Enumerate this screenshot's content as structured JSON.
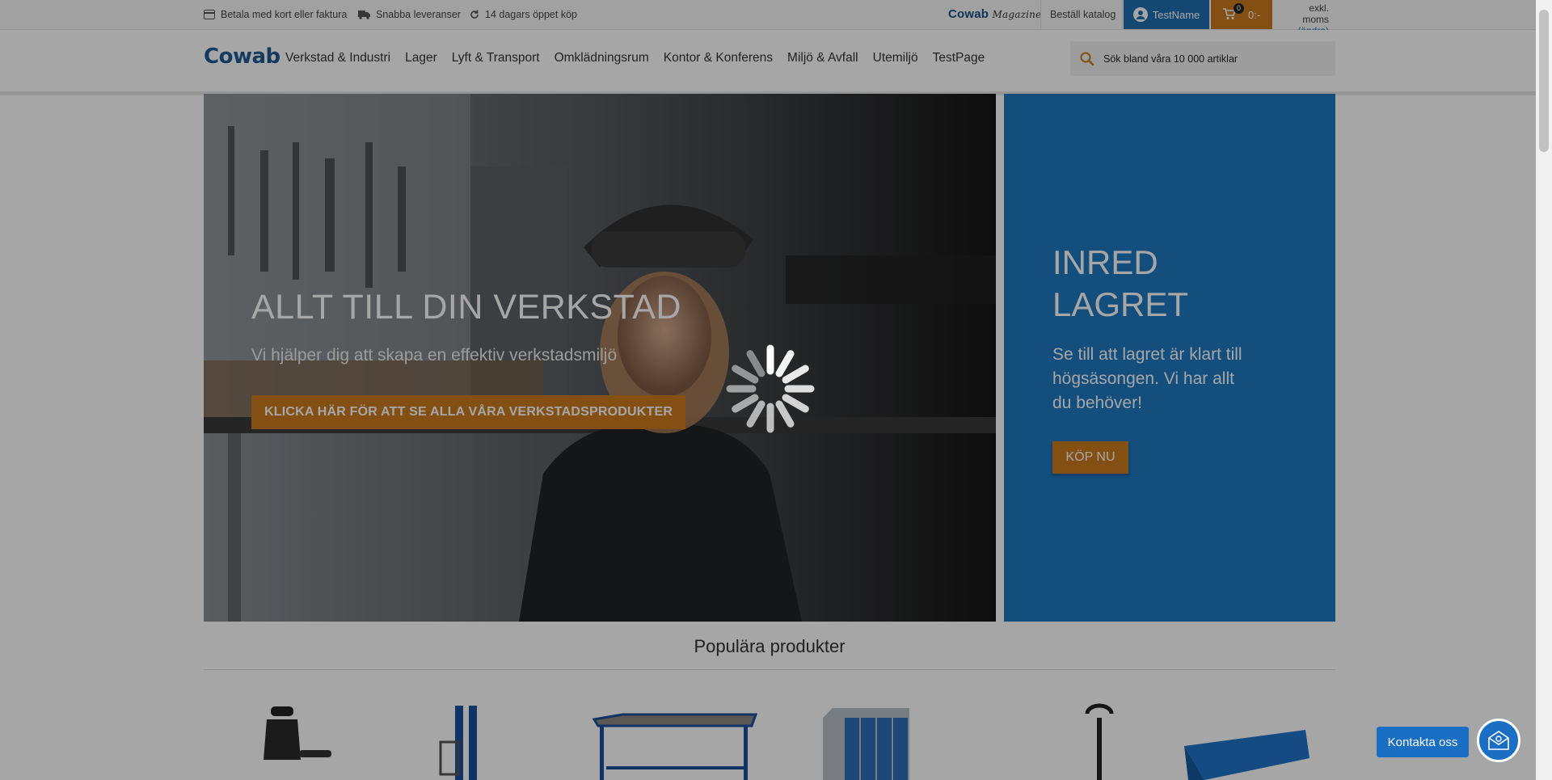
{
  "topbar": {
    "usp1": "Betala med kort eller faktura",
    "usp2": "Snabba leveranser",
    "usp3": "14 dagars öppet köp",
    "magazine_brand": "Cowab",
    "magazine_word": "Magazine",
    "catalog": "Beställ katalog",
    "user": "TestName",
    "cart_count": "0",
    "cart_total": "0:-",
    "vat": "exkl. moms",
    "vat_change": "(ändra)"
  },
  "nav": {
    "logo": "Cowab",
    "items": [
      "Verkstad & Industri",
      "Lager",
      "Lyft & Transport",
      "Omklädningsrum",
      "Kontor & Konferens",
      "Miljö & Avfall",
      "Utemiljö",
      "TestPage"
    ],
    "search_placeholder": "Sök bland våra 10 000 artiklar"
  },
  "hero": {
    "title": "ALLT TILL DIN VERKSTAD",
    "subtitle": "Vi hjälper dig att skapa en effektiv verkstadsmiljö",
    "button": "KLICKA HÄR FÖR ATT SE ALLA VÅRA VERKSTADSPRODUKTER"
  },
  "promo": {
    "title": "INRED LAGRET",
    "text": "Se till att lagret är klart till högsäsongen. Vi har allt du behöver!",
    "button": "KÖP NU"
  },
  "popular": {
    "title": "Populära produkter"
  },
  "contact": {
    "label": "Kontakta oss"
  },
  "colors": {
    "brand_blue": "#1f78c1",
    "accent_orange": "#c97a1e",
    "logo_blue": "#1f5a93"
  }
}
